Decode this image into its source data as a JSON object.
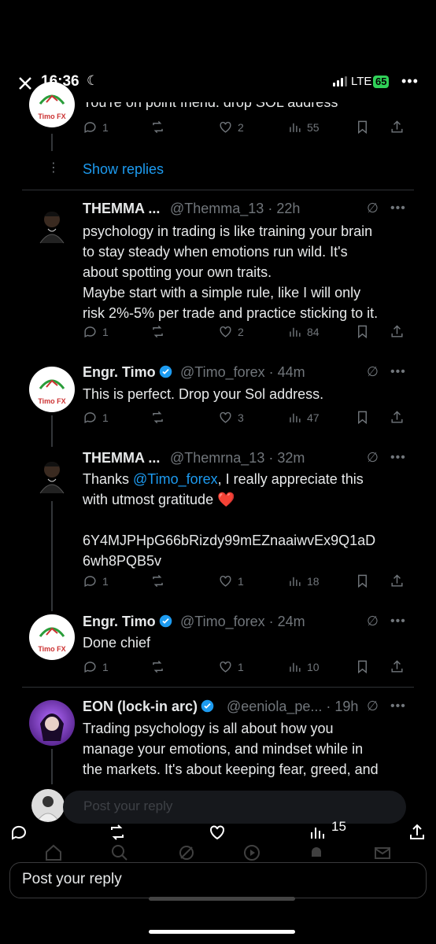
{
  "status_bar": {
    "time": "16:36",
    "network": "LTE",
    "battery": "65"
  },
  "top_tweet": {
    "partial_text": "You're on point friend. drop SOL address",
    "stats": {
      "reply": "1",
      "like": "2",
      "views": "55"
    }
  },
  "show_replies_label": "Show replies",
  "tweets": [
    {
      "name": "THEMMA ...",
      "handle": "@Themma_13 · 22h",
      "lines": [
        "psychology in trading is like training your brain",
        "to stay steady when emotions run wild. It's",
        "about spotting your own  traits.",
        "Maybe start with a simple rule, like I will only",
        "risk 2%-5% per trade and practice sticking to it."
      ],
      "stats": {
        "reply": "1",
        "like": "2",
        "views": "84"
      }
    },
    {
      "name": "Engr. Timo",
      "handle": "@Timo_forex · 44m",
      "lines": [
        "This is perfect.  Drop your Sol address."
      ],
      "stats": {
        "reply": "1",
        "like": "3",
        "views": "47"
      }
    },
    {
      "name": "THEMMA ...",
      "handle": "@Themrna_13 · 32m",
      "line1_pre": "Thanks ",
      "mention": "@Timo_forex",
      "line1_post": ", I really appreciate this",
      "line2": "with utmost gratitude ❤️",
      "address1": "6Y4MJPHpG66bRizdy99mEZnaaiwvEx9Q1aD",
      "address2": "6wh8PQB5v",
      "stats": {
        "reply": "1",
        "like": "1",
        "views": "18"
      }
    },
    {
      "name": "Engr. Timo",
      "handle": "@Timo_forex · 24m",
      "lines": [
        "Done chief"
      ],
      "stats": {
        "reply": "1",
        "like": "1",
        "views": "10"
      }
    },
    {
      "name": "EON (lock-in arc)",
      "handle": "@eeniola_pe... · 19h",
      "lines": [
        "Trading psychology is all about how you",
        "manage your emotions, and mindset while in",
        "the markets. It's about keeping fear, greed, and"
      ]
    }
  ],
  "reply_box_placeholder": "Post your reply",
  "bottom_bar": {
    "views": "15"
  },
  "reply_field_placeholder": "Post your reply",
  "timo_avatar_text": "Timo FX",
  "colors": {
    "accent": "#1d9bf0",
    "muted": "#71767b",
    "heart": "#f91880",
    "battery": "#30d158"
  }
}
